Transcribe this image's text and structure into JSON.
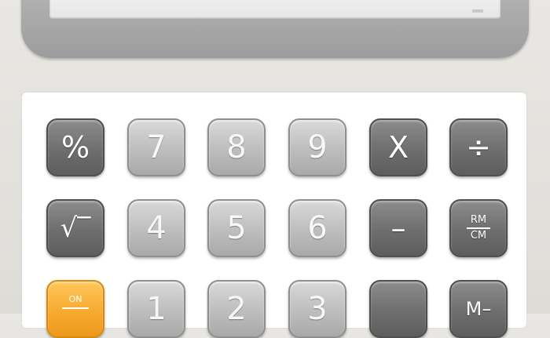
{
  "display": {
    "value": ""
  },
  "keys": {
    "percent": "%",
    "seven": "7",
    "eight": "8",
    "nine": "9",
    "multiply": "X",
    "divide": "÷",
    "sqrt": "√‾",
    "four": "4",
    "five": "5",
    "six": "6",
    "minus": "–",
    "rm": "RM",
    "cm": "CM",
    "on": "ON",
    "one": "1",
    "two": "2",
    "three": "3",
    "mminus": "M–"
  },
  "colors": {
    "accent_orange": "#f6a82c",
    "key_light": "#bdbdbd",
    "key_dark": "#6e6e6e",
    "bezel": "#a8a8a8"
  }
}
